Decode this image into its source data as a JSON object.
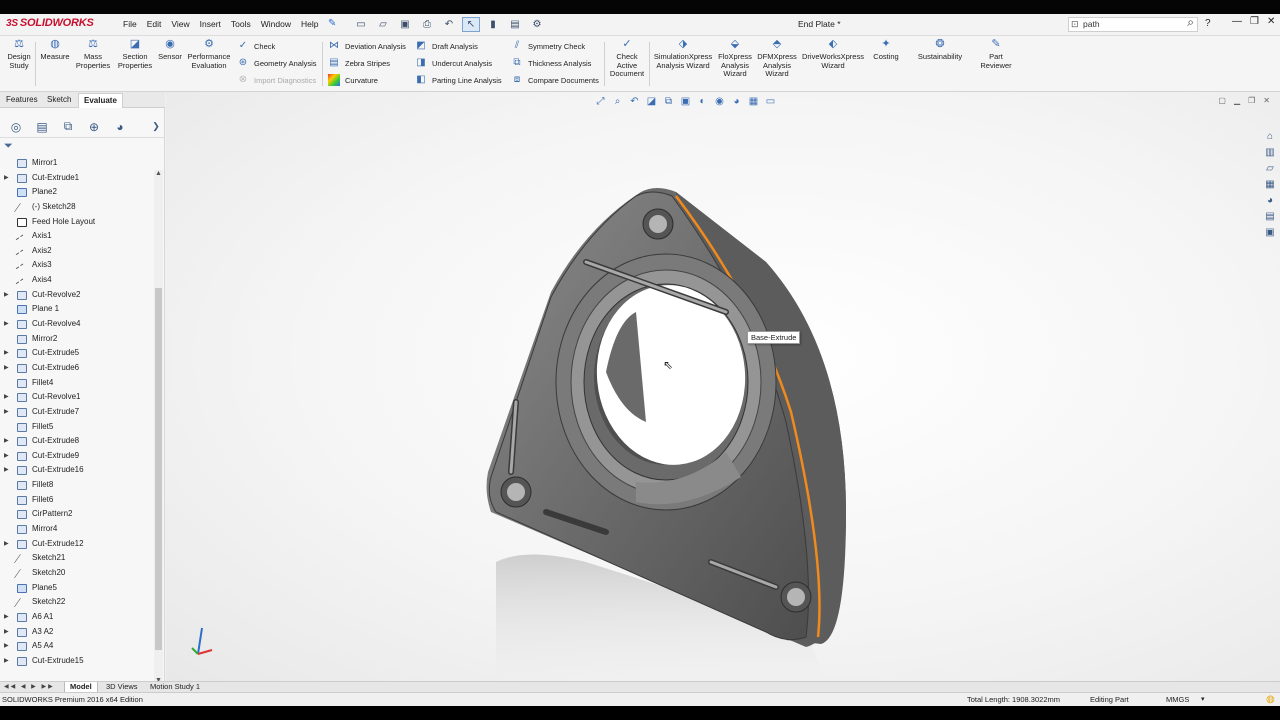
{
  "app": {
    "logo": "SOLIDWORKS",
    "doc_title": "End Plate *"
  },
  "menu": [
    "File",
    "Edit",
    "View",
    "Insert",
    "Tools",
    "Window",
    "Help"
  ],
  "search": {
    "value": "path"
  },
  "help_label": "?",
  "ribbon": {
    "big": [
      {
        "label": "Design Study",
        "icon": "design-study-icon"
      },
      {
        "label": "Measure",
        "icon": "measure-icon"
      },
      {
        "label": "Mass Properties",
        "icon": "mass-properties-icon"
      },
      {
        "label": "Section Properties",
        "icon": "section-properties-icon"
      },
      {
        "label": "Sensor",
        "icon": "sensor-icon"
      },
      {
        "label": "Performance Evaluation",
        "icon": "performance-icon"
      }
    ],
    "col1": [
      {
        "label": "Check",
        "enabled": true
      },
      {
        "label": "Geometry Analysis",
        "enabled": true
      },
      {
        "label": "Import Diagnostics",
        "enabled": false
      }
    ],
    "col2": [
      "Deviation Analysis",
      "Zebra Stripes",
      "Curvature"
    ],
    "col3": [
      "Draft Analysis",
      "Undercut Analysis",
      "Parting Line Analysis"
    ],
    "col4": [
      "Symmetry Check",
      "Thickness Analysis",
      "Compare Documents"
    ],
    "check_active": "Check Active Document",
    "big2": [
      {
        "label": "SimulationXpress Analysis Wizard"
      },
      {
        "label": "FloXpress Analysis Wizard"
      },
      {
        "label": "DFMXpress Analysis Wizard"
      },
      {
        "label": "DriveWorksXpress Wizard"
      },
      {
        "label": "Costing"
      },
      {
        "label": "Sustainability"
      },
      {
        "label": "Part Reviewer"
      }
    ]
  },
  "cm_tabs": [
    "Features",
    "Sketch",
    "Evaluate"
  ],
  "active_tab": "Evaluate",
  "tree": [
    {
      "label": "Mirror1",
      "type": "mirror",
      "expand": false
    },
    {
      "label": "Cut-Extrude1",
      "type": "feature",
      "expand": true
    },
    {
      "label": "Plane2",
      "type": "plane",
      "expand": false
    },
    {
      "label": "(-) Sketch28",
      "type": "sketch",
      "expand": false
    },
    {
      "label": "Feed Hole Layout",
      "type": "3d",
      "expand": false
    },
    {
      "label": "Axis1",
      "type": "axis",
      "expand": false
    },
    {
      "label": "Axis2",
      "type": "axis",
      "expand": false
    },
    {
      "label": "Axis3",
      "type": "axis",
      "expand": false
    },
    {
      "label": "Axis4",
      "type": "axis",
      "expand": false
    },
    {
      "label": "Cut-Revolve2",
      "type": "feature",
      "expand": true
    },
    {
      "label": "Plane 1",
      "type": "plane",
      "expand": false
    },
    {
      "label": "Cut-Revolve4",
      "type": "feature",
      "expand": true
    },
    {
      "label": "Mirror2",
      "type": "mirror",
      "expand": false
    },
    {
      "label": "Cut-Extrude5",
      "type": "feature",
      "expand": true
    },
    {
      "label": "Cut-Extrude6",
      "type": "feature",
      "expand": true
    },
    {
      "label": "Fillet4",
      "type": "fillet",
      "expand": false
    },
    {
      "label": "Cut-Revolve1",
      "type": "feature",
      "expand": true
    },
    {
      "label": "Cut-Extrude7",
      "type": "feature",
      "expand": true
    },
    {
      "label": "Fillet5",
      "type": "fillet",
      "expand": false
    },
    {
      "label": "Cut-Extrude8",
      "type": "feature",
      "expand": true
    },
    {
      "label": "Cut-Extrude9",
      "type": "feature",
      "expand": true
    },
    {
      "label": "Cut-Extrude16",
      "type": "feature",
      "expand": true
    },
    {
      "label": "Fillet8",
      "type": "fillet",
      "expand": false
    },
    {
      "label": "Fillet6",
      "type": "fillet",
      "expand": false
    },
    {
      "label": "CirPattern2",
      "type": "mirror",
      "expand": false
    },
    {
      "label": "Mirror4",
      "type": "mirror",
      "expand": false
    },
    {
      "label": "Cut-Extrude12",
      "type": "feature",
      "expand": true
    },
    {
      "label": "Sketch21",
      "type": "sketch",
      "expand": false
    },
    {
      "label": "Sketch20",
      "type": "sketch",
      "expand": false
    },
    {
      "label": "Plane5",
      "type": "plane",
      "expand": false
    },
    {
      "label": "Sketch22",
      "type": "sketch",
      "expand": false
    },
    {
      "label": "A6 A1",
      "type": "feature",
      "expand": true
    },
    {
      "label": "A3 A2",
      "type": "feature",
      "expand": true
    },
    {
      "label": "A5 A4",
      "type": "feature",
      "expand": true
    },
    {
      "label": "Cut-Extrude15",
      "type": "feature",
      "expand": true
    }
  ],
  "bottom_tabs": [
    "Model",
    "3D Views",
    "Motion Study 1"
  ],
  "status": {
    "edition": "SOLIDWORKS Premium 2016 x64 Edition",
    "total_length": "Total Length: 1908.3022mm",
    "mode": "Editing Part",
    "units": "MMGS"
  },
  "tooltip": "Base-Extrude",
  "colors": {
    "accent": "#3b6db3",
    "highlight_edge": "#f08a1c",
    "logo": "#c8102e"
  }
}
